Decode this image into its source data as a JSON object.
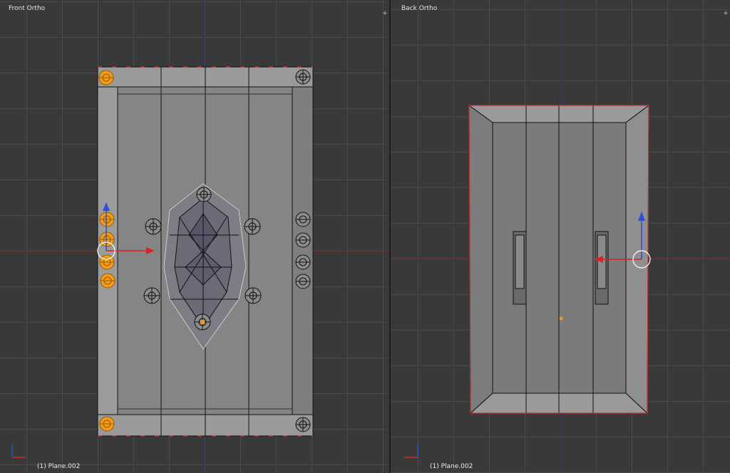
{
  "viewports": {
    "left": {
      "title": "Front Ortho",
      "status": "(1) Plane.002"
    },
    "right": {
      "title": "Back Ortho",
      "status": "(1) Plane.002"
    }
  },
  "colors": {
    "background": "#393939",
    "grid": "#4a4a4a",
    "mesh_face": "#8a8a8a",
    "mesh_edge": "#000000",
    "x_axis": "#d12b2b",
    "z_axis": "#2b4cd1",
    "selected": "#f29c1a"
  },
  "icons": {
    "split_corner": "plus-icon",
    "manipulator": "transform-manipulator-icon",
    "axis_widget": "axis-orientation-icon"
  }
}
